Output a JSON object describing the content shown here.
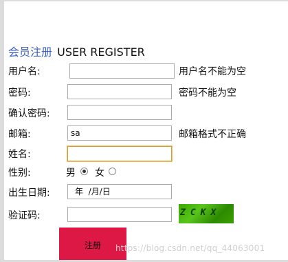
{
  "header": {
    "title_cn": "会员注册",
    "title_en": "USER REGISTER"
  },
  "form": {
    "username": {
      "label": "用户名:",
      "value": "",
      "error": "用户名不能为空"
    },
    "password": {
      "label": "密码:",
      "value": "",
      "error": "密码不能为空"
    },
    "confirm_password": {
      "label": "确认密码:",
      "value": ""
    },
    "email": {
      "label": "邮箱:",
      "value": "sa",
      "error": "邮箱格式不正确"
    },
    "name": {
      "label": "姓名:",
      "value": ""
    },
    "gender": {
      "label": "性别:",
      "options": [
        {
          "label": "男",
          "checked": true
        },
        {
          "label": "女",
          "checked": false
        }
      ]
    },
    "birthdate": {
      "label": "出生日期:",
      "display": "年  /月/日"
    },
    "captcha": {
      "label": "验证码:",
      "value": "",
      "image_text": "ZCKX"
    },
    "submit_label": "注册"
  },
  "watermark": "https://blog.csdn.net/qq_44063001"
}
